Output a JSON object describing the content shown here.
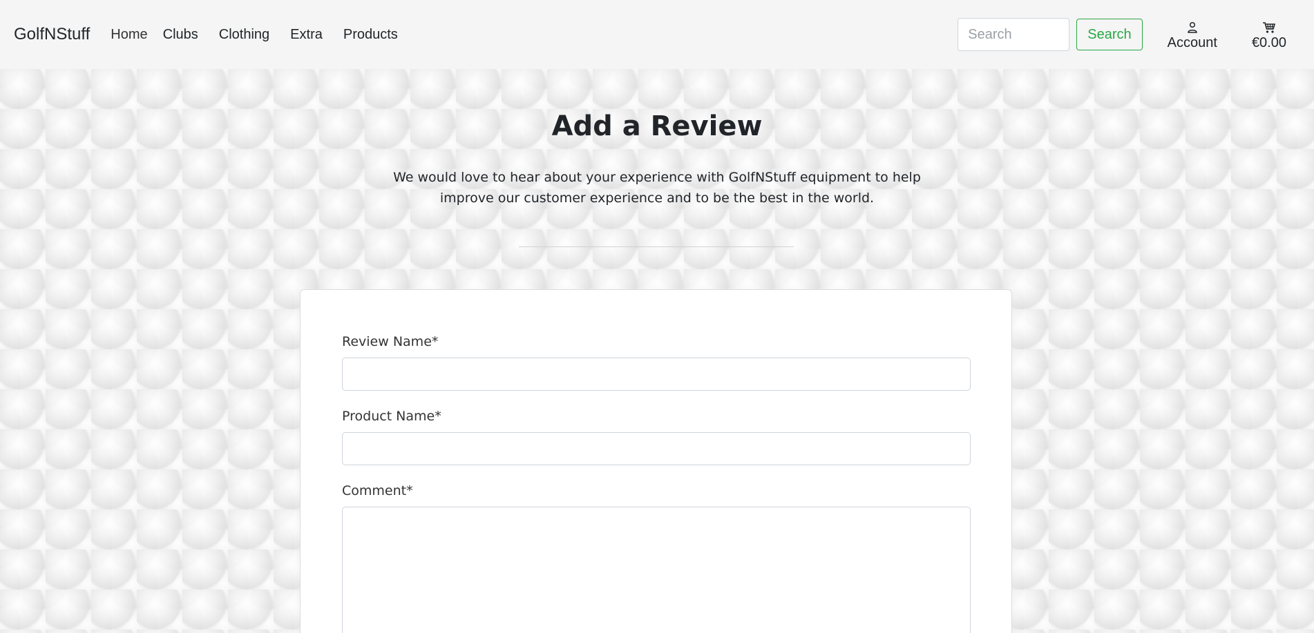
{
  "navbar": {
    "brand": "GolfNStuff",
    "links": [
      "Home",
      "Clubs",
      "Clothing",
      "Extra",
      "Products"
    ],
    "search_placeholder": "Search",
    "search_button": "Search",
    "account_label": "Account",
    "account_icon": "person-icon",
    "cart_total": "€0.00",
    "cart_icon": "shopping-cart-icon"
  },
  "header": {
    "title": "Add a Review",
    "intro": "We would love to hear about your experience with GolfNStuff equipment to help improve our customer experience and to be the best in the world."
  },
  "form": {
    "review_name_label": "Review Name*",
    "review_name_value": "",
    "product_name_label": "Product Name*",
    "product_name_value": "",
    "comment_label": "Comment*",
    "comment_value": ""
  },
  "colors": {
    "accent": "#28a745",
    "navbar_bg": "#f5f5f5",
    "text": "#212529"
  }
}
